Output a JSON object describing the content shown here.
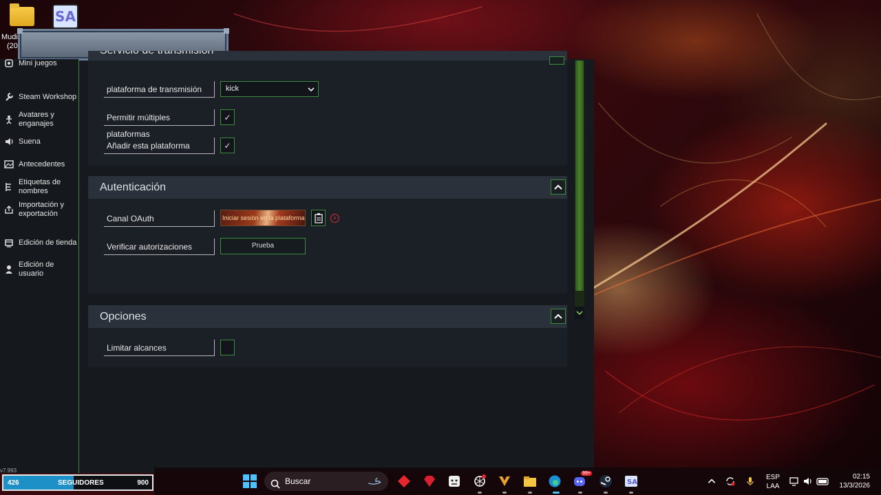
{
  "desktop": {
    "icon_label_line1": "Mudi",
    "icon_label_line2": "(20",
    "sa_icon_text": "SA"
  },
  "sidebar": {
    "items": [
      {
        "label": "Mini juegos",
        "icon": "gamepad-icon"
      },
      {
        "label": "Steam Workshop",
        "icon": "wrench-icon"
      },
      {
        "label": "Avatares y enganajes",
        "icon": "person-icon"
      },
      {
        "label": "Suena",
        "icon": "speaker-icon"
      },
      {
        "label": "Antecedentes",
        "icon": "image-icon"
      },
      {
        "label": "Etiquetas de nombres",
        "icon": "tag-icon"
      },
      {
        "label": "Importación y exportación",
        "icon": "import-export-icon"
      },
      {
        "label": "Edición de tienda",
        "icon": "cart-icon"
      },
      {
        "label": "Edición de usuario",
        "icon": "user-icon"
      }
    ],
    "version": "v7.993"
  },
  "sections": {
    "streaming": {
      "title": "Servicio de transmisión",
      "platform_label": "plataforma de transmisión",
      "platform_value": "kick",
      "multi_label": "Permitir múltiples plataformas",
      "multi_checked": true,
      "add_label": "Añadir esta plataforma",
      "add_checked": true,
      "check_glyph": "✓"
    },
    "auth": {
      "title": "Autenticación",
      "oauth_label": "Canal OAuth",
      "oauth_button": "Iniciar sesión en la plataforma",
      "verify_label": "Verificar autorizaciones",
      "test_button": "Prueba"
    },
    "options": {
      "title": "Opciones",
      "limit_label": "Limitar alcances",
      "limit_checked": false
    }
  },
  "followers": {
    "current": "426",
    "label": "SEGUIDORES",
    "goal": "900",
    "progress_fraction": 0.47
  },
  "taskbar": {
    "search_placeholder": "Buscar",
    "language": "ESP",
    "layout": "LAA",
    "time": "02:15",
    "date": "13/3/2026",
    "discord_badge": "99+"
  }
}
